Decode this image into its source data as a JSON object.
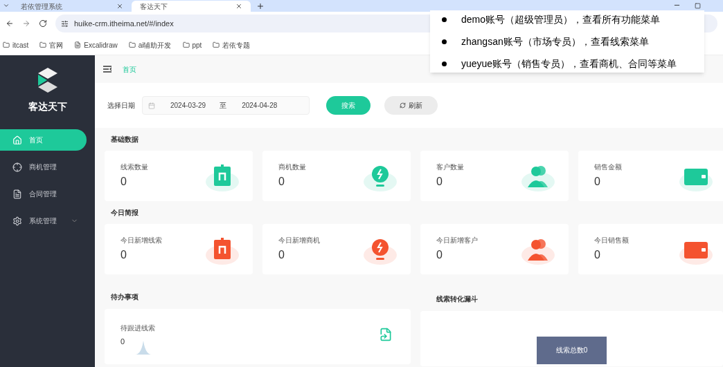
{
  "browser": {
    "tabs": [
      {
        "title": "若依管理系统",
        "selected": false
      },
      {
        "title": "客达天下",
        "selected": true
      }
    ],
    "url": "huike-crm.itheima.net/#/index",
    "bookmarks": [
      {
        "label": "itcast",
        "kind": "folder"
      },
      {
        "label": "官网",
        "kind": "folder"
      },
      {
        "label": "Excalidraw",
        "kind": "file"
      },
      {
        "label": "ai辅助开发",
        "kind": "folder"
      },
      {
        "label": "ppt",
        "kind": "folder"
      },
      {
        "label": "若依专题",
        "kind": "folder"
      }
    ]
  },
  "note": {
    "items": [
      "demo账号（超级管理员），查看所有功能菜单",
      "zhangsan账号（市场专员），查看线索菜单",
      "yueyue账号（销售专员），查看商机、合同等菜单"
    ]
  },
  "sidebar": {
    "brand": "客达天下",
    "items": [
      {
        "label": "首页",
        "kind": "home",
        "selected": true,
        "expandable": false
      },
      {
        "label": "商机管理",
        "kind": "target",
        "selected": false,
        "expandable": false
      },
      {
        "label": "合同管理",
        "kind": "file",
        "selected": false,
        "expandable": false
      },
      {
        "label": "系统管理",
        "kind": "gear",
        "selected": false,
        "expandable": true
      }
    ]
  },
  "header": {
    "breadcrumb": "首页"
  },
  "filter": {
    "label": "选择日期",
    "start": "2024-03-29",
    "separator": "至",
    "end": "2024-04-28",
    "search_button": "搜索",
    "refresh_button": "刷新"
  },
  "stat_sections": [
    {
      "title": "基础数据",
      "color": "#1ec99a",
      "cards": [
        {
          "label": "线索数量",
          "value": "0",
          "kind": "bag"
        },
        {
          "label": "商机数量",
          "value": "0",
          "kind": "bulb"
        },
        {
          "label": "客户数量",
          "value": "0",
          "kind": "users"
        },
        {
          "label": "销售金额",
          "value": "0",
          "kind": "wallet"
        }
      ]
    },
    {
      "title": "今日简报",
      "color": "#f4532f",
      "cards": [
        {
          "label": "今日新增线索",
          "value": "0",
          "kind": "bag"
        },
        {
          "label": "今日新增商机",
          "value": "0",
          "kind": "bulb"
        },
        {
          "label": "今日新增客户",
          "value": "0",
          "kind": "users"
        },
        {
          "label": "今日销售额",
          "value": "0",
          "kind": "wallet"
        }
      ]
    }
  ],
  "todo": {
    "title": "待办事项",
    "items": [
      {
        "label": "待跟进线索",
        "value": "0"
      }
    ]
  },
  "funnel": {
    "title": "线索转化漏斗",
    "bar_label": "线索总数0"
  }
}
